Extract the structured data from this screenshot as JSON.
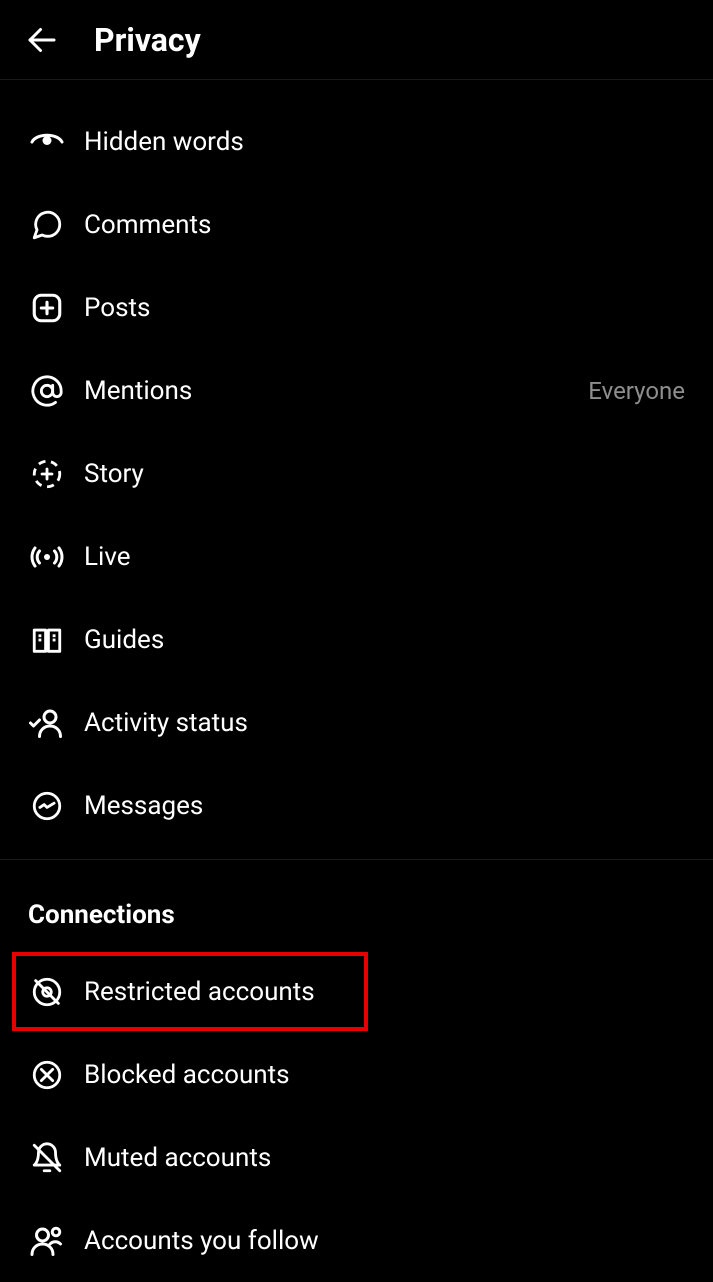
{
  "header": {
    "title": "Privacy"
  },
  "section1": {
    "items": [
      {
        "label": "Hidden words",
        "value": ""
      },
      {
        "label": "Comments",
        "value": ""
      },
      {
        "label": "Posts",
        "value": ""
      },
      {
        "label": "Mentions",
        "value": "Everyone"
      },
      {
        "label": "Story",
        "value": ""
      },
      {
        "label": "Live",
        "value": ""
      },
      {
        "label": "Guides",
        "value": ""
      },
      {
        "label": "Activity status",
        "value": ""
      },
      {
        "label": "Messages",
        "value": ""
      }
    ]
  },
  "section2": {
    "title": "Connections",
    "items": [
      {
        "label": "Restricted accounts"
      },
      {
        "label": "Blocked accounts"
      },
      {
        "label": "Muted accounts"
      },
      {
        "label": "Accounts you follow"
      }
    ]
  }
}
